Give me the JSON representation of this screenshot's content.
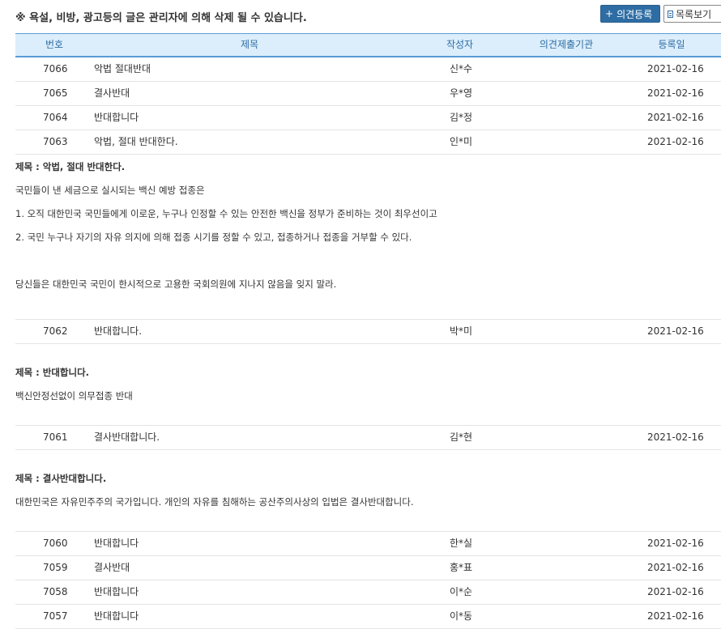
{
  "notice": "※ 욕설, 비방, 광고등의 글은 관리자에 의해 삭제 될 수 있습니다.",
  "buttons": {
    "register_icon": "+",
    "register": "의견등록",
    "list": "목록보기",
    "list_icon": "document-icon"
  },
  "columns": {
    "no": "번호",
    "title": "제목",
    "writer": "작성자",
    "org": "의견제출기관",
    "date": "등록일"
  },
  "rows": [
    {
      "no": "7066",
      "title": "악법 절대반대",
      "writer": "신*수",
      "org": "",
      "date": "2021-02-16"
    },
    {
      "no": "7065",
      "title": "결사반대",
      "writer": "우*영",
      "org": "",
      "date": "2021-02-16"
    },
    {
      "no": "7064",
      "title": "반대합니다",
      "writer": "김*정",
      "org": "",
      "date": "2021-02-16"
    },
    {
      "no": "7063",
      "title": "악법, 절대 반대한다.",
      "writer": "인*미",
      "org": "",
      "date": "2021-02-16"
    },
    {
      "no": "7062",
      "title": "반대합니다.",
      "writer": "박*미",
      "org": "",
      "date": "2021-02-16"
    },
    {
      "no": "7061",
      "title": "결사반대합니다.",
      "writer": "김*현",
      "org": "",
      "date": "2021-02-16"
    },
    {
      "no": "7060",
      "title": "반대합니다",
      "writer": "한*실",
      "org": "",
      "date": "2021-02-16"
    },
    {
      "no": "7059",
      "title": "결사반대",
      "writer": "홍*표",
      "org": "",
      "date": "2021-02-16"
    },
    {
      "no": "7058",
      "title": "반대합니다",
      "writer": "이*순",
      "org": "",
      "date": "2021-02-16"
    },
    {
      "no": "7057",
      "title": "반대합니다",
      "writer": "이*동",
      "org": "",
      "date": "2021-02-16"
    }
  ],
  "details": {
    "d7063": {
      "title": "제목 : 악법, 절대 반대한다.",
      "lines": [
        "국민들이 낸 세금으로 실시되는 백신 예방 접종은",
        "1. 오직 대한민국 국민들에게 이로운, 누구나 인정할 수 있는 안전한 백신을 정부가 준비하는 것이 최우선이고",
        "2. 국민 누구나 자기의 자유 의지에 의해 접종 시기를 정할 수 있고, 접종하거나 접종을 거부할 수 있다.",
        "당신들은 대한민국 국민이 한시적으로 고용한 국회의원에 지나지 않음을 잊지 말라."
      ]
    },
    "d7062": {
      "title": "제목 : 반대합니다.",
      "lines": [
        "백신안정선없이 의무접종 반대"
      ]
    },
    "d7061": {
      "title": "제목 : 결사반대합니다.",
      "lines": [
        "대한민국은 자유민주주의 국가입니다. 개인의 자유를 침해하는 공산주의사상의 입법은 결사반대합니다."
      ]
    }
  }
}
